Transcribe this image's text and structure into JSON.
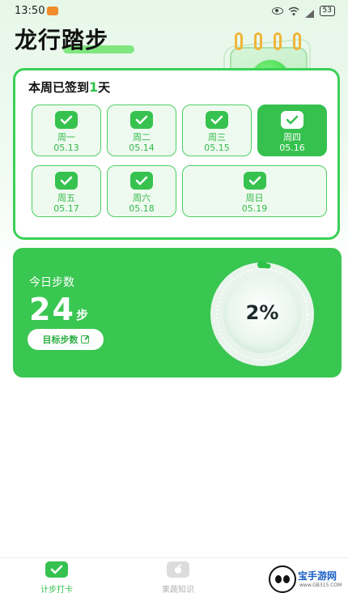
{
  "status_bar": {
    "time": "13:50",
    "battery": "53"
  },
  "header": {
    "title": "龙行踏步"
  },
  "week": {
    "title_prefix": "本周已签到",
    "count": "1",
    "title_suffix": "天",
    "days": [
      {
        "name": "周一",
        "date": "05.13",
        "checked": true,
        "active": false
      },
      {
        "name": "周二",
        "date": "05.14",
        "checked": true,
        "active": false
      },
      {
        "name": "周三",
        "date": "05.15",
        "checked": true,
        "active": false
      },
      {
        "name": "周四",
        "date": "05.16",
        "checked": true,
        "active": true
      },
      {
        "name": "周五",
        "date": "05.17",
        "checked": true,
        "active": false
      },
      {
        "name": "周六",
        "date": "05.18",
        "checked": true,
        "active": false
      },
      {
        "name": "周日",
        "date": "05.19",
        "checked": true,
        "active": false
      }
    ]
  },
  "steps": {
    "label": "今日步数",
    "value": "24",
    "unit": "步",
    "goal_button": "目标步数",
    "progress_text": "2%",
    "progress_fraction": 0.02
  },
  "tabs": [
    {
      "label": "计步打卡",
      "icon": "checkin-icon",
      "active": true
    },
    {
      "label": "果蔬知识",
      "icon": "knowledge-icon",
      "active": false
    }
  ],
  "watermark": {
    "text": "宝手游网",
    "small": "www.GB315.COM"
  },
  "colors": {
    "primary": "#39c651",
    "primary_dark": "#2fae45",
    "light_bg": "#eefaef"
  }
}
